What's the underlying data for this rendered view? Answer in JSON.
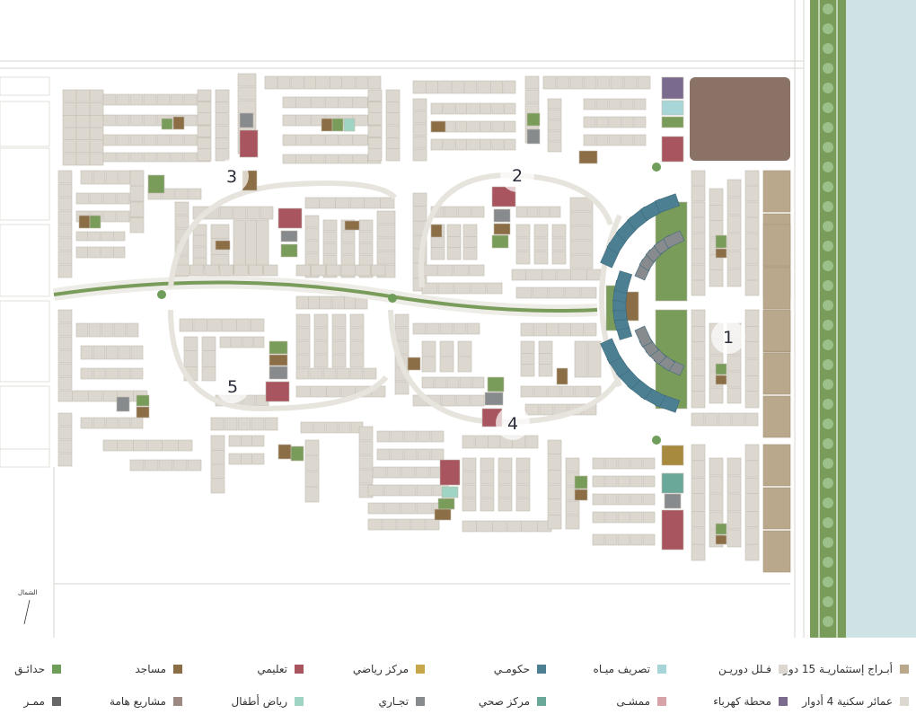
{
  "map": {
    "zones": [
      {
        "id": "1",
        "label": "1"
      },
      {
        "id": "2",
        "label": "2"
      },
      {
        "id": "3",
        "label": "3"
      },
      {
        "id": "4",
        "label": "4"
      },
      {
        "id": "5",
        "label": "5"
      }
    ],
    "north_label": "الشمال",
    "colors": {
      "plot": "#dcd8d0",
      "plot_stroke": "#c3bdb2",
      "road": "#f4f3ef",
      "towers": "#b9a88c",
      "water_tank": "#8a7266",
      "park": "#7a9c5a",
      "mosque": "#8b6e45",
      "education": "#a85560",
      "sports": "#a88a3e",
      "government": "#4c7f92",
      "water": "#a8d6d8",
      "commercial": "#888b8e",
      "health": "#6aa89a",
      "walkway": "#d7a3a8",
      "kindergarten": "#9fd3c4",
      "power": "#7a6a8e",
      "river": "#cfe2e6",
      "greenbelt": "#6f9d5a"
    }
  },
  "legend": {
    "rows": [
      [
        {
          "label": "أبـراج إستثماريـة 15 دور",
          "color": "#b9a88c"
        },
        {
          "label": "فـلل دوريـن",
          "color": "#dcd8d0"
        },
        {
          "label": "تصريف ميـاه",
          "color": "#a8d6d8"
        },
        {
          "label": "حكومـي",
          "color": "#4c7f92"
        },
        {
          "label": "مركز رياضي",
          "color": "#c8a64a"
        },
        {
          "label": "تعليمي",
          "color": "#a85560"
        },
        {
          "label": "مساجد",
          "color": "#8b6e45"
        },
        {
          "label": "حدائـق",
          "color": "#6f9d5a"
        }
      ],
      [
        {
          "label": "عمائر سكنية 4 أدوار",
          "color": "#dcd8d0"
        },
        {
          "label": "محطة كهرباء",
          "color": "#7a6a8e"
        },
        {
          "label": "ممشـى",
          "color": "#d7a3a8"
        },
        {
          "label": "مركز صحي",
          "color": "#6aa89a"
        },
        {
          "label": "تجـاري",
          "color": "#888b8e"
        },
        {
          "label": "رياض أطفال",
          "color": "#9fd3c4"
        },
        {
          "label": "مشاريع هامة",
          "color": "#9c8a82"
        },
        {
          "label": "ممـر",
          "color": "#666666"
        }
      ]
    ]
  }
}
